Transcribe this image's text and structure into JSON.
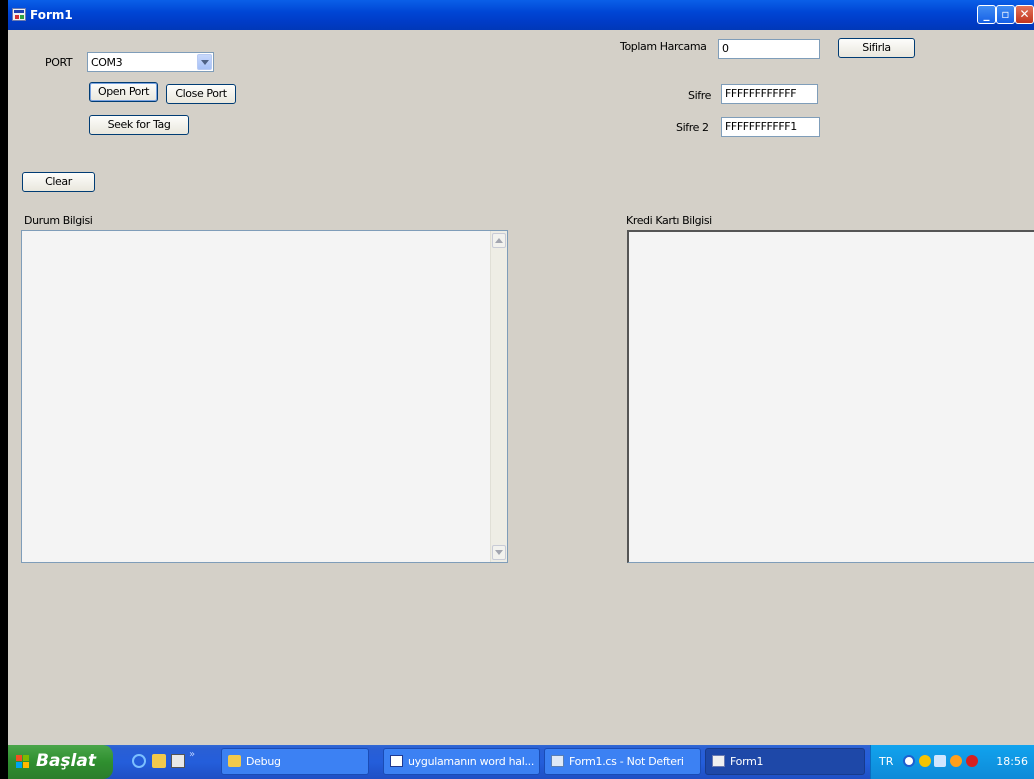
{
  "window": {
    "title": "Form1"
  },
  "port": {
    "label": "PORT",
    "selected": "COM3"
  },
  "buttons": {
    "open_port": "Open Port",
    "close_port": "Close Port",
    "seek_tag": "Seek for Tag",
    "clear": "Clear",
    "sifirla": "Sifirla"
  },
  "fields": {
    "toplam_label": "Toplam Harcama",
    "toplam_value": "0",
    "sifre_label": "Sifre",
    "sifre_value": "FFFFFFFFFFFF",
    "sifre2_label": "Sifre 2",
    "sifre2_value": "FFFFFFFFFFF1"
  },
  "panels": {
    "durum_label": "Durum Bilgisi",
    "kredi_label": "Kredi Kartı Bilgisi"
  },
  "taskbar": {
    "start_label": "Başlat",
    "tasks": [
      "Debug",
      "uygulamanın word hal...",
      "Form1.cs - Not Defteri",
      "Form1"
    ],
    "language": "TR",
    "clock": "18:56"
  },
  "colors": {
    "titlebar": "#0046d5",
    "form_bg": "#d4d0c8",
    "taskbar": "#245edb",
    "start_green": "#2f8f2f",
    "close_red": "#c0351e"
  }
}
